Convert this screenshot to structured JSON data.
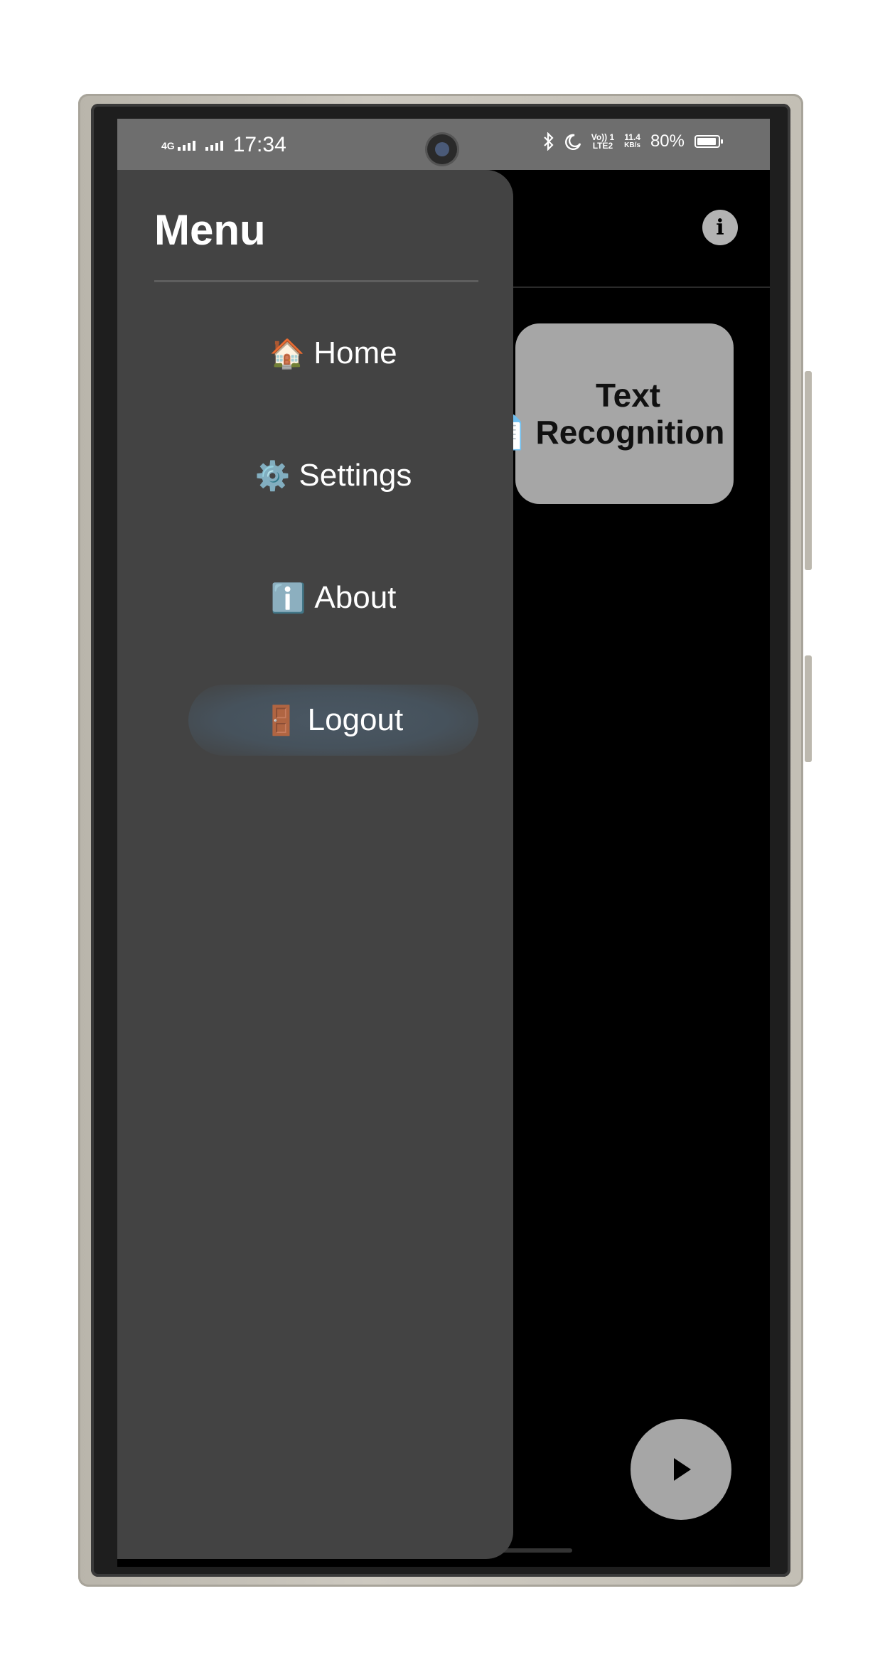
{
  "status_bar": {
    "network_top": "4G",
    "time": "17:34",
    "volte_top": "Vo)) 1",
    "volte_bottom": "LTE2",
    "speed_value": "11.4",
    "speed_unit": "KB/s",
    "battery_percent": "80%",
    "icons": [
      "signal-icon",
      "bluetooth-icon",
      "moon-icon",
      "battery-icon"
    ]
  },
  "app": {
    "info_icon": "i",
    "feature_card": {
      "icon": "📄",
      "label": "Text Recognition"
    },
    "fab_icon": "play-icon"
  },
  "drawer": {
    "title": "Menu",
    "items": [
      {
        "emoji": "🏠",
        "label": "Home",
        "active": false
      },
      {
        "emoji": "⚙️",
        "label": "Settings",
        "active": false
      },
      {
        "emoji": "ℹ️",
        "label": "About",
        "active": false
      },
      {
        "emoji": "🚪",
        "label": "Logout",
        "active": true
      }
    ]
  },
  "colors": {
    "drawer_bg": "#434343",
    "status_bar_bg": "#6e6e6e",
    "card_bg": "#a6a6a6",
    "app_bg": "#000000"
  }
}
